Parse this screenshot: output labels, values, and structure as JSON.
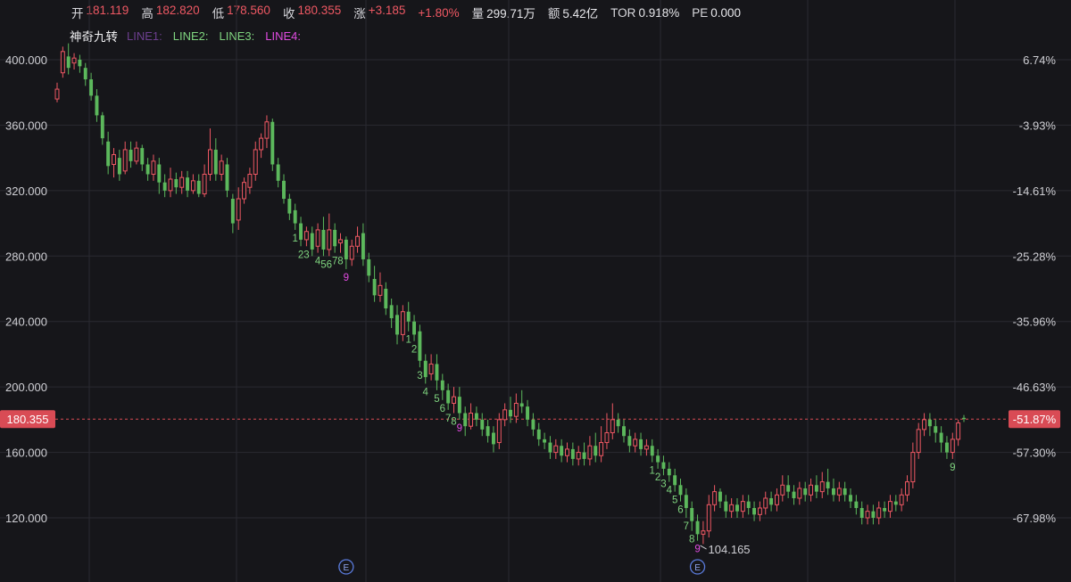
{
  "stats": [
    {
      "label": "开",
      "value": "181.119",
      "tone": "up"
    },
    {
      "label": "高",
      "value": "182.820",
      "tone": "up"
    },
    {
      "label": "低",
      "value": "178.560",
      "tone": "up"
    },
    {
      "label": "收",
      "value": "180.355",
      "tone": "up"
    },
    {
      "label": "涨",
      "value": "+3.185",
      "tone": "up"
    },
    {
      "label": "",
      "value": "+1.80%",
      "tone": "up"
    },
    {
      "label": "量",
      "value": "299.71万",
      "tone": "neutral"
    },
    {
      "label": "额",
      "value": "5.42亿",
      "tone": "neutral"
    },
    {
      "label": "TOR",
      "value": "0.918%",
      "tone": "neutral"
    },
    {
      "label": "PE",
      "value": "0.000",
      "tone": "neutral"
    }
  ],
  "indicator": {
    "name": "神奇九转",
    "lines": [
      {
        "label": "LINE1:",
        "color": "#6d3f8f"
      },
      {
        "label": "LINE2:",
        "color": "#7fd47f"
      },
      {
        "label": "LINE3:",
        "color": "#7fd47f"
      },
      {
        "label": "LINE4:",
        "color": "#e04be0"
      }
    ]
  },
  "colors": {
    "up": "#ee5863",
    "down": "#5cb85c",
    "grid": "#2a2a31",
    "background": "#16161a",
    "current_price_line": "#d94b55",
    "seq_green": "#7fd47f",
    "seq_magenta": "#e04be0",
    "earnings_marker": "#5a7bdc"
  },
  "chart_data": {
    "type": "candlestick",
    "yaxis_left": {
      "min": 104,
      "max": 410,
      "ticks": [
        {
          "value": 400,
          "label": "400.000"
        },
        {
          "value": 360,
          "label": "360.000"
        },
        {
          "value": 320,
          "label": "320.000"
        },
        {
          "value": 280,
          "label": "280.000"
        },
        {
          "value": 240,
          "label": "240.000"
        },
        {
          "value": 200,
          "label": "200.000"
        },
        {
          "value": 160,
          "label": "160.000"
        },
        {
          "value": 120,
          "label": "120.000"
        }
      ]
    },
    "yaxis_right": {
      "ticks": [
        {
          "value": 400,
          "label": "6.74%"
        },
        {
          "value": 360,
          "label": "-3.93%"
        },
        {
          "value": 320,
          "label": "-14.61%"
        },
        {
          "value": 280,
          "label": "-25.28%"
        },
        {
          "value": 240,
          "label": "-35.96%"
        },
        {
          "value": 200,
          "label": "-46.63%"
        },
        {
          "value": 160,
          "label": "-57.30%"
        },
        {
          "value": 120,
          "label": "-67.98%"
        }
      ]
    },
    "current_price": {
      "value": 180.355,
      "label_left": "180.355",
      "label_right": "-51.87%"
    },
    "low_annotation": {
      "index": 113,
      "value": 104.165,
      "label": "104.165"
    },
    "earnings_markers": [
      {
        "index": 51,
        "label": "E"
      },
      {
        "index": 113,
        "label": "E"
      }
    ],
    "candles": [
      [
        376,
        382,
        374,
        386
      ],
      [
        392,
        405,
        389,
        408
      ],
      [
        402,
        395,
        391,
        410
      ],
      [
        398,
        401,
        394,
        404
      ],
      [
        400,
        396,
        392,
        403
      ],
      [
        395,
        388,
        384,
        398
      ],
      [
        388,
        378,
        375,
        392
      ],
      [
        378,
        366,
        362,
        382
      ],
      [
        366,
        352,
        348,
        368
      ],
      [
        350,
        335,
        330,
        356
      ],
      [
        336,
        342,
        328,
        346
      ],
      [
        340,
        330,
        326,
        345
      ],
      [
        332,
        345,
        330,
        350
      ],
      [
        345,
        338,
        334,
        350
      ],
      [
        338,
        346,
        336,
        350
      ],
      [
        346,
        336,
        332,
        348
      ],
      [
        336,
        330,
        326,
        340
      ],
      [
        330,
        338,
        326,
        342
      ],
      [
        336,
        325,
        318,
        340
      ],
      [
        325,
        320,
        316,
        330
      ],
      [
        320,
        327,
        316,
        334
      ],
      [
        327,
        322,
        318,
        331
      ],
      [
        322,
        328,
        318,
        332
      ],
      [
        328,
        320,
        316,
        332
      ],
      [
        320,
        326,
        318,
        330
      ],
      [
        326,
        318,
        316,
        330
      ],
      [
        318,
        330,
        316,
        336
      ],
      [
        330,
        345,
        326,
        358
      ],
      [
        345,
        330,
        326,
        352
      ],
      [
        330,
        338,
        326,
        342
      ],
      [
        336,
        320,
        316,
        340
      ],
      [
        315,
        300,
        294,
        318
      ],
      [
        302,
        315,
        296,
        322
      ],
      [
        315,
        325,
        312,
        328
      ],
      [
        322,
        330,
        318,
        334
      ],
      [
        330,
        345,
        326,
        350
      ],
      [
        345,
        352,
        340,
        355
      ],
      [
        352,
        362,
        346,
        366
      ],
      [
        362,
        336,
        332,
        364
      ],
      [
        336,
        326,
        322,
        340
      ],
      [
        326,
        315,
        312,
        330
      ],
      [
        315,
        306,
        302,
        318
      ],
      [
        308,
        300,
        296,
        312
      ],
      [
        300,
        290,
        286,
        304
      ],
      [
        290,
        295,
        286,
        298
      ],
      [
        294,
        284,
        280,
        298
      ],
      [
        286,
        296,
        282,
        300
      ],
      [
        296,
        284,
        280,
        304
      ],
      [
        284,
        296,
        280,
        306
      ],
      [
        296,
        286,
        282,
        300
      ],
      [
        288,
        290,
        282,
        294
      ],
      [
        290,
        278,
        272,
        292
      ],
      [
        278,
        286,
        274,
        290
      ],
      [
        286,
        292,
        282,
        298
      ],
      [
        294,
        278,
        274,
        300
      ],
      [
        278,
        268,
        264,
        282
      ],
      [
        266,
        256,
        252,
        274
      ],
      [
        256,
        262,
        252,
        270
      ],
      [
        260,
        248,
        244,
        264
      ],
      [
        250,
        242,
        236,
        254
      ],
      [
        244,
        232,
        226,
        250
      ],
      [
        232,
        246,
        228,
        250
      ],
      [
        246,
        240,
        234,
        252
      ],
      [
        240,
        232,
        228,
        244
      ],
      [
        234,
        216,
        212,
        238
      ],
      [
        216,
        206,
        202,
        220
      ],
      [
        208,
        214,
        204,
        220
      ],
      [
        214,
        204,
        198,
        220
      ],
      [
        204,
        198,
        192,
        208
      ],
      [
        198,
        190,
        186,
        202
      ],
      [
        190,
        194,
        184,
        200
      ],
      [
        194,
        184,
        180,
        200
      ],
      [
        184,
        176,
        170,
        188
      ],
      [
        176,
        184,
        174,
        190
      ],
      [
        184,
        180,
        176,
        188
      ],
      [
        180,
        174,
        170,
        184
      ],
      [
        176,
        170,
        166,
        180
      ],
      [
        172,
        165,
        160,
        176
      ],
      [
        166,
        180,
        162,
        184
      ],
      [
        180,
        186,
        176,
        190
      ],
      [
        186,
        182,
        178,
        194
      ],
      [
        182,
        190,
        178,
        196
      ],
      [
        190,
        188,
        184,
        198
      ],
      [
        188,
        180,
        176,
        192
      ],
      [
        180,
        174,
        170,
        184
      ],
      [
        174,
        168,
        164,
        178
      ],
      [
        168,
        166,
        162,
        172
      ],
      [
        166,
        160,
        156,
        170
      ],
      [
        160,
        164,
        156,
        168
      ],
      [
        164,
        158,
        154,
        168
      ],
      [
        158,
        162,
        154,
        166
      ],
      [
        162,
        156,
        152,
        166
      ],
      [
        156,
        160,
        152,
        164
      ],
      [
        160,
        156,
        152,
        166
      ],
      [
        156,
        164,
        152,
        170
      ],
      [
        164,
        158,
        154,
        172
      ],
      [
        158,
        166,
        154,
        176
      ],
      [
        166,
        172,
        162,
        184
      ],
      [
        172,
        180,
        168,
        190
      ],
      [
        180,
        176,
        172,
        184
      ],
      [
        176,
        170,
        166,
        180
      ],
      [
        170,
        164,
        160,
        174
      ],
      [
        164,
        168,
        160,
        172
      ],
      [
        168,
        162,
        158,
        172
      ],
      [
        162,
        164,
        158,
        168
      ],
      [
        164,
        158,
        154,
        168
      ],
      [
        158,
        154,
        150,
        162
      ],
      [
        154,
        150,
        146,
        158
      ],
      [
        150,
        146,
        142,
        154
      ],
      [
        146,
        140,
        136,
        150
      ],
      [
        140,
        134,
        130,
        144
      ],
      [
        134,
        126,
        120,
        138
      ],
      [
        126,
        118,
        112,
        130
      ],
      [
        118,
        110,
        106,
        122
      ],
      [
        110,
        112,
        104,
        118
      ],
      [
        112,
        128,
        108,
        134
      ],
      [
        128,
        136,
        124,
        140
      ],
      [
        136,
        130,
        126,
        138
      ],
      [
        130,
        124,
        120,
        134
      ],
      [
        124,
        128,
        120,
        132
      ],
      [
        128,
        124,
        120,
        132
      ],
      [
        124,
        130,
        120,
        134
      ],
      [
        130,
        126,
        122,
        134
      ],
      [
        126,
        122,
        118,
        130
      ],
      [
        122,
        126,
        118,
        130
      ],
      [
        126,
        132,
        122,
        136
      ],
      [
        132,
        128,
        124,
        136
      ],
      [
        128,
        134,
        124,
        138
      ],
      [
        134,
        140,
        130,
        146
      ],
      [
        140,
        136,
        132,
        146
      ],
      [
        136,
        132,
        128,
        140
      ],
      [
        132,
        138,
        128,
        142
      ],
      [
        138,
        134,
        130,
        142
      ],
      [
        134,
        140,
        130,
        144
      ],
      [
        140,
        136,
        132,
        146
      ],
      [
        136,
        142,
        132,
        148
      ],
      [
        142,
        138,
        134,
        150
      ],
      [
        138,
        134,
        130,
        144
      ],
      [
        134,
        138,
        130,
        142
      ],
      [
        138,
        134,
        130,
        142
      ],
      [
        134,
        130,
        126,
        138
      ],
      [
        130,
        126,
        122,
        134
      ],
      [
        126,
        120,
        116,
        130
      ],
      [
        120,
        124,
        116,
        128
      ],
      [
        124,
        120,
        116,
        128
      ],
      [
        120,
        126,
        116,
        130
      ],
      [
        126,
        124,
        120,
        130
      ],
      [
        124,
        130,
        120,
        134
      ],
      [
        130,
        128,
        124,
        134
      ],
      [
        128,
        134,
        124,
        138
      ],
      [
        134,
        142,
        130,
        146
      ],
      [
        142,
        160,
        138,
        166
      ],
      [
        160,
        174,
        156,
        178
      ],
      [
        174,
        180,
        170,
        184
      ],
      [
        180,
        176,
        170,
        184
      ],
      [
        176,
        172,
        166,
        180
      ],
      [
        172,
        166,
        160,
        176
      ],
      [
        166,
        160,
        156,
        170
      ],
      [
        160,
        168,
        156,
        172
      ],
      [
        168,
        178,
        164,
        180
      ],
      [
        181.119,
        180.355,
        178.56,
        182.82
      ]
    ],
    "td_labels": [
      {
        "i": 42,
        "t": "1",
        "c": "green"
      },
      {
        "i": 43,
        "t": "2",
        "c": "green"
      },
      {
        "i": 44,
        "t": "3",
        "c": "green"
      },
      {
        "i": 46,
        "t": "4",
        "c": "green"
      },
      {
        "i": 47,
        "t": "5",
        "c": "green"
      },
      {
        "i": 48,
        "t": "6",
        "c": "green"
      },
      {
        "i": 49,
        "t": "7",
        "c": "green"
      },
      {
        "i": 50,
        "t": "8",
        "c": "green"
      },
      {
        "i": 51,
        "t": "9",
        "c": "magenta"
      },
      {
        "i": 62,
        "t": "1",
        "c": "green"
      },
      {
        "i": 63,
        "t": "2",
        "c": "green"
      },
      {
        "i": 64,
        "t": "3",
        "c": "green"
      },
      {
        "i": 65,
        "t": "4",
        "c": "green"
      },
      {
        "i": 67,
        "t": "5",
        "c": "green"
      },
      {
        "i": 68,
        "t": "6",
        "c": "green"
      },
      {
        "i": 69,
        "t": "7",
        "c": "green"
      },
      {
        "i": 70,
        "t": "8",
        "c": "green"
      },
      {
        "i": 71,
        "t": "9",
        "c": "magenta"
      },
      {
        "i": 105,
        "t": "1",
        "c": "green"
      },
      {
        "i": 106,
        "t": "2",
        "c": "green"
      },
      {
        "i": 107,
        "t": "3",
        "c": "green"
      },
      {
        "i": 108,
        "t": "4",
        "c": "green"
      },
      {
        "i": 109,
        "t": "5",
        "c": "green"
      },
      {
        "i": 110,
        "t": "6",
        "c": "green"
      },
      {
        "i": 111,
        "t": "7",
        "c": "green"
      },
      {
        "i": 112,
        "t": "8",
        "c": "green"
      },
      {
        "i": 113,
        "t": "9",
        "c": "magenta"
      },
      {
        "i": 158,
        "t": "9",
        "c": "green"
      }
    ]
  }
}
